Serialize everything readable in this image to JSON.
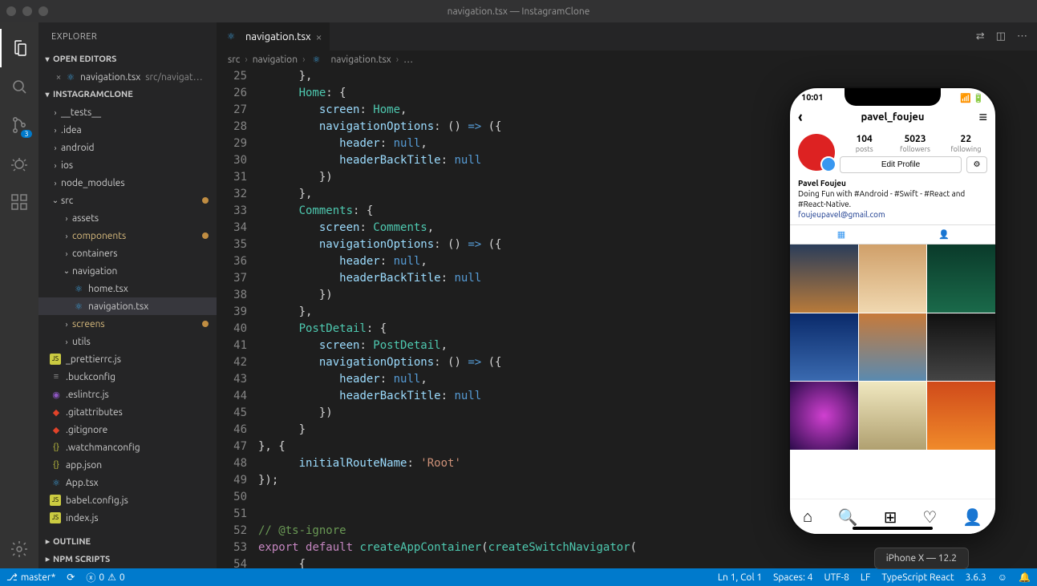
{
  "window": {
    "title": "navigation.tsx — InstagramClone"
  },
  "sidebar": {
    "title": "EXPLORER",
    "openEditorsHeader": "OPEN EDITORS",
    "projectHeader": "INSTAGRAMCLONE",
    "outlineHeader": "OUTLINE",
    "npmHeader": "NPM SCRIPTS",
    "openEditor": {
      "name": "navigation.tsx",
      "path": "src/navigat…"
    },
    "tree": {
      "tests": "__tests__",
      "idea": ".idea",
      "android": "android",
      "ios": "ios",
      "node_modules": "node_modules",
      "src": "src",
      "assets": "assets",
      "components": "components",
      "containers": "containers",
      "navigation": "navigation",
      "hometsx": "home.tsx",
      "navtsx": "navigation.tsx",
      "screens": "screens",
      "utils": "utils",
      "prettier": "_prettierrc.js",
      "buck": ".buckconfig",
      "eslint": ".eslintrc.js",
      "gitattributes": ".gitattributes",
      "gitignore": ".gitignore",
      "watchman": ".watchmanconfig",
      "appjson": "app.json",
      "apptsx": "App.tsx",
      "babel": "babel.config.js",
      "indexjs": "index.js"
    }
  },
  "tab": {
    "name": "navigation.tsx"
  },
  "breadcrumbs": {
    "p1": "src",
    "p2": "navigation",
    "p3": "navigation.tsx",
    "p4": "…"
  },
  "code": {
    "startLine": 25,
    "lines": [
      "      },",
      "      Home: {",
      "         screen: Home,",
      "         navigationOptions: () => ({",
      "            header: null,",
      "            headerBackTitle: null",
      "         })",
      "      },",
      "      Comments: {",
      "         screen: Comments,",
      "         navigationOptions: () => ({",
      "            header: null,",
      "            headerBackTitle: null",
      "         })",
      "      },",
      "      PostDetail: {",
      "         screen: PostDetail,",
      "         navigationOptions: () => ({",
      "            header: null,",
      "            headerBackTitle: null",
      "         })",
      "      }",
      "}, {",
      "      initialRouteName: 'Root'",
      "});",
      "",
      "",
      "// @ts-ignore",
      "export default createAppContainer(createSwitchNavigator(",
      "      {"
    ]
  },
  "phone": {
    "time": "10:01",
    "username": "pavel_foujeu",
    "stats": {
      "posts": "104",
      "postsLabel": "posts",
      "followers": "5023",
      "followersLabel": "followers",
      "following": "22",
      "followingLabel": "following"
    },
    "editProfile": "Edit Profile",
    "name": "Pavel Foujeu",
    "bio": "Doing Fun with #Android - #Swift - #React and #React-Native.",
    "email": "foujeupavel@gmail.com",
    "deviceLabel": "iPhone X — 12.2"
  },
  "statusbar": {
    "branch": "master*",
    "errors": "0",
    "warnings": "0",
    "lncol": "Ln 1, Col 1",
    "spaces": "Spaces: 4",
    "encoding": "UTF-8",
    "eol": "LF",
    "lang": "TypeScript React",
    "ver": "3.6.3"
  },
  "activitybar": {
    "scmBadge": "3"
  }
}
